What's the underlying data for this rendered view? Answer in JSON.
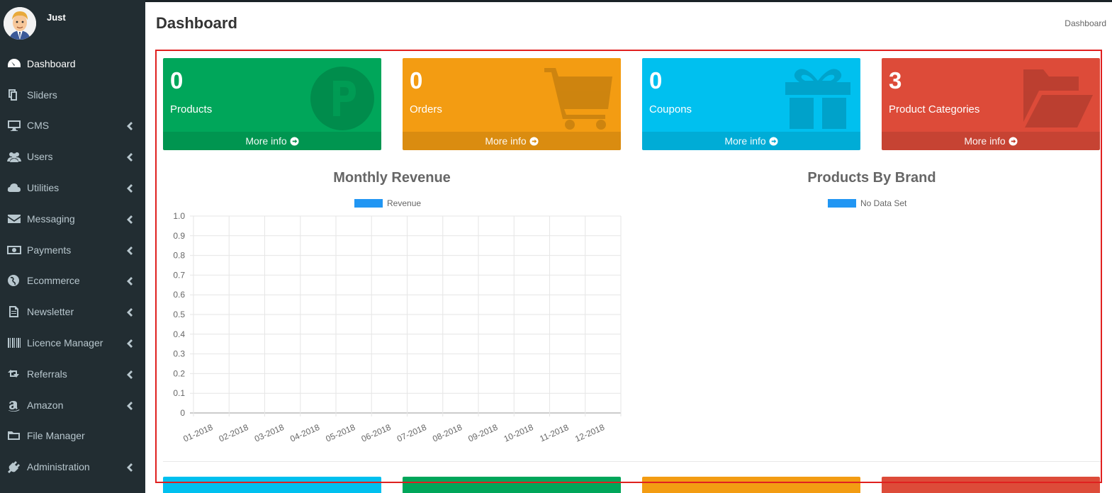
{
  "user": {
    "name": "Just"
  },
  "sidebar": {
    "items": [
      {
        "label": "Dashboard",
        "icon": "dashboard-icon",
        "active": true,
        "submenu": false
      },
      {
        "label": "Sliders",
        "icon": "copy-icon",
        "active": false,
        "submenu": false
      },
      {
        "label": "CMS",
        "icon": "desktop-icon",
        "active": false,
        "submenu": true
      },
      {
        "label": "Users",
        "icon": "users-icon",
        "active": false,
        "submenu": true
      },
      {
        "label": "Utilities",
        "icon": "cloud-icon",
        "active": false,
        "submenu": true
      },
      {
        "label": "Messaging",
        "icon": "envelope-icon",
        "active": false,
        "submenu": true
      },
      {
        "label": "Payments",
        "icon": "money-icon",
        "active": false,
        "submenu": true
      },
      {
        "label": "Ecommerce",
        "icon": "globe-icon",
        "active": false,
        "submenu": true
      },
      {
        "label": "Newsletter",
        "icon": "file-text-icon",
        "active": false,
        "submenu": true
      },
      {
        "label": "Licence Manager",
        "icon": "barcode-icon",
        "active": false,
        "submenu": true
      },
      {
        "label": "Referrals",
        "icon": "retweet-icon",
        "active": false,
        "submenu": true
      },
      {
        "label": "Amazon",
        "icon": "amazon-icon",
        "active": false,
        "submenu": true
      },
      {
        "label": "File Manager",
        "icon": "folder-icon",
        "active": false,
        "submenu": false
      },
      {
        "label": "Administration",
        "icon": "plug-icon",
        "active": false,
        "submenu": true
      }
    ]
  },
  "header": {
    "title": "Dashboard",
    "breadcrumb": "Dashboard"
  },
  "boxes": [
    {
      "value": "0",
      "label": "Products",
      "footer": "More info",
      "color": "#00a65a",
      "icon": "product-p-icon"
    },
    {
      "value": "0",
      "label": "Orders",
      "footer": "More info",
      "color": "#f39c12",
      "icon": "shopping-cart-icon"
    },
    {
      "value": "0",
      "label": "Coupons",
      "footer": "More info",
      "color": "#00c0ef",
      "icon": "gift-icon"
    },
    {
      "value": "3",
      "label": "Product Categories",
      "footer": "More info",
      "color": "#dd4b39",
      "icon": "folder-open-icon"
    }
  ],
  "bottom_boxes": [
    {
      "color": "#00c0ef"
    },
    {
      "color": "#00a65a"
    },
    {
      "color": "#f39c12"
    },
    {
      "color": "#dd4b39"
    }
  ],
  "chart_data": [
    {
      "type": "bar",
      "title": "Monthly Revenue",
      "categories": [
        "01-2018",
        "02-2018",
        "03-2018",
        "04-2018",
        "05-2018",
        "06-2018",
        "07-2018",
        "08-2018",
        "09-2018",
        "10-2018",
        "11-2018",
        "12-2018"
      ],
      "series": [
        {
          "name": "Revenue",
          "values": [
            0,
            0,
            0,
            0,
            0,
            0,
            0,
            0,
            0,
            0,
            0,
            0
          ],
          "color": "#2196f3"
        }
      ],
      "yticks": [
        "1.0",
        "0.9",
        "0.8",
        "0.7",
        "0.6",
        "0.5",
        "0.4",
        "0.3",
        "0.2",
        "0.1",
        "0"
      ],
      "ylim": [
        0,
        1
      ],
      "grid": true,
      "legend": "top-center"
    },
    {
      "type": "pie",
      "title": "Products By Brand",
      "series": [
        {
          "name": "No Data Set",
          "values": [],
          "color": "#2196f3"
        }
      ],
      "legend": "top-center"
    }
  ]
}
